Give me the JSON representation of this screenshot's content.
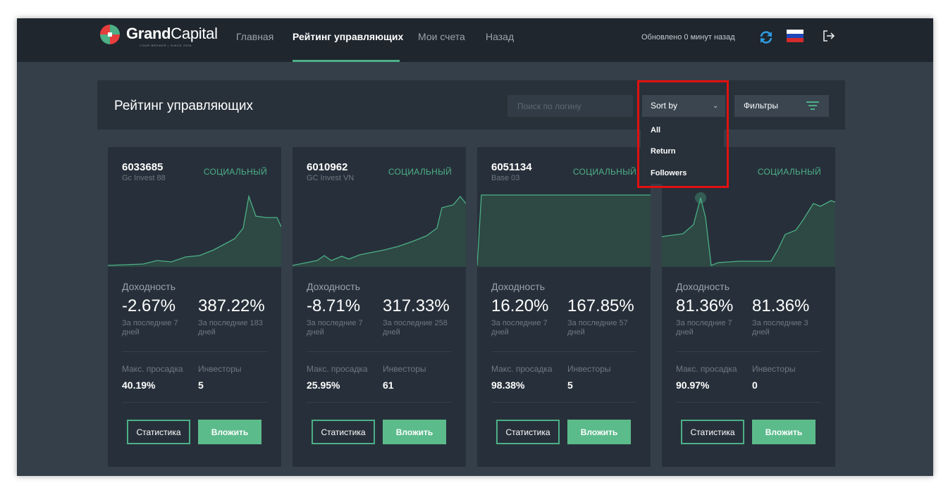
{
  "header": {
    "logo": {
      "brand_bold": "Grand",
      "brand_light": "Capital",
      "tagline": "YOUR BROKER  |  SINCE 2006"
    },
    "nav": [
      {
        "label": "Главная",
        "active": false
      },
      {
        "label": "Рейтинг управляющих",
        "active": true
      },
      {
        "label": "Мои счета",
        "active": false
      },
      {
        "label": "Назад",
        "active": false
      }
    ],
    "updated": "Обновлено 0 минут назад",
    "icons": {
      "refresh": "refresh-icon",
      "flag": "russia-flag-icon",
      "logout": "logout-icon"
    },
    "colors": {
      "accent": "#4caf86",
      "refresh": "#2f9ae0"
    }
  },
  "toolbar": {
    "title": "Рейтинг управляющих",
    "search_placeholder": "Поиск по логину",
    "sort_label": "Sort by",
    "filters_label": "Фильтры",
    "sort_options": [
      "All",
      "Return",
      "Followers"
    ]
  },
  "card_labels": {
    "return_label": "Доходность",
    "drawdown_label": "Макс. просадка",
    "investors_label": "Инвесторы",
    "stats_button": "Статистика",
    "invest_button": "Вложить"
  },
  "cards": [
    {
      "id": "6033685",
      "name": "Gc Invest 88",
      "type": "СОЦИАЛЬНЫЙ",
      "return_7d": "-2.67%",
      "return_all": "387.22%",
      "period_7": "За последние 7 дней",
      "period_all": "За последние 183 дней",
      "max_drawdown": "40.19%",
      "investors": "5"
    },
    {
      "id": "6010962",
      "name": "GC Invest VN",
      "type": "СОЦИАЛЬНЫЙ",
      "return_7d": "-8.71%",
      "return_all": "317.33%",
      "period_7": "За последние 7 дней",
      "period_all": "За последние 258 дней",
      "max_drawdown": "25.95%",
      "investors": "61"
    },
    {
      "id": "6051134",
      "name": "Base 03",
      "type": "СОЦИАЛЬНЫЙ",
      "return_7d": "16.20%",
      "return_all": "167.85%",
      "period_7": "За последние 7 дней",
      "period_all": "За последние 57 дней",
      "max_drawdown": "98.38%",
      "investors": "5"
    },
    {
      "id": "",
      "name": "",
      "type": "СОЦИАЛЬНЫЙ",
      "return_7d": "81.36%",
      "return_all": "81.36%",
      "period_7": "За последние 7 дней",
      "period_all": "За последние 3 дней",
      "max_drawdown": "90.97%",
      "investors": "0"
    }
  ]
}
